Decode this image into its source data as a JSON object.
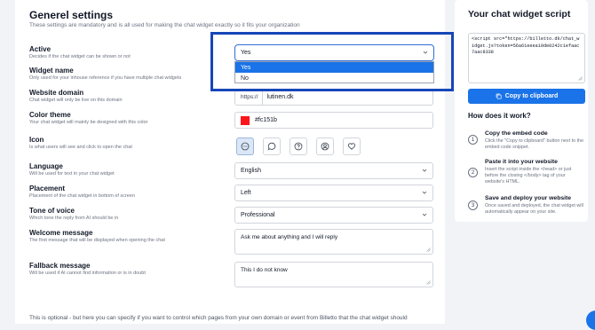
{
  "general": {
    "title": "Generel settings",
    "description": "These settings are mandatory and is all used for making the chat widget exactly so it fits your organization"
  },
  "rows": {
    "active": {
      "label": "Active",
      "help": "Decides if the chat widget can be shown or not",
      "value": "Yes",
      "options": [
        "Yes",
        "No"
      ],
      "selected_option": "Yes"
    },
    "widget_name": {
      "label": "Widget name",
      "help": "Only used for your inhouse reference if you have multiple chat widgets"
    },
    "website_domain": {
      "label": "Website domain",
      "help": "Chat widget will only be live on this domain",
      "prefix": "https://",
      "value": "lutinen.dk"
    },
    "color_theme": {
      "label": "Color theme",
      "help": "Your chat widget will mainly be designed with this color",
      "value": "#fc151b",
      "swatch_color": "#fc151b"
    },
    "icon": {
      "label": "Icon",
      "help": "Is what users will see and click to open the chat",
      "icons": [
        "chat-bubble-dots-icon",
        "chat-bubble-icon",
        "question-icon",
        "user-circle-icon",
        "heart-icon"
      ],
      "selected_index": 0
    },
    "language": {
      "label": "Language",
      "help": "Will be used for text in your chat widget",
      "value": "English"
    },
    "placement": {
      "label": "Placement",
      "help": "Placement of the chat widget in bottom of screen",
      "value": "Left"
    },
    "tone": {
      "label": "Tone of voice",
      "help": "Which tone the reply from AI should be in",
      "value": "Professional"
    },
    "welcome": {
      "label": "Welcome message",
      "help": "The first message that will be displayed when opening the chat",
      "value": "Ask me about anything and I will reply"
    },
    "fallback": {
      "label": "Fallback message",
      "help": "Will be used if AI cannot find information or is in doubt",
      "value": "This I do not know"
    }
  },
  "footer_text": "This is optional - but here you can specify if you want to control which pages from your own domain or event from Billetto that the chat widget should",
  "script_panel": {
    "title": "Your chat widget script",
    "code": "<script src=\"https://billetto.dk/chat_widget.js?token=56a61eeea10de0242c1efaac7aac8338",
    "copy_label": "Copy to clipboard",
    "how_title": "How does it work?",
    "steps": [
      {
        "num": "1",
        "title": "Copy the embed code",
        "desc": "Click the \"Copy to clipboard\" button next to the embed code snippet."
      },
      {
        "num": "2",
        "title": "Paste it into your website",
        "desc": "Insert the script inside the <head> or just before the closing </body> tag of your website's HTML."
      },
      {
        "num": "3",
        "title": "Save and deploy your website",
        "desc": "Once saved and deployed, the chat widget will automatically appear on your site."
      }
    ]
  },
  "colors": {
    "accent": "#1a73e8",
    "highlight_border": "#1646b8"
  }
}
